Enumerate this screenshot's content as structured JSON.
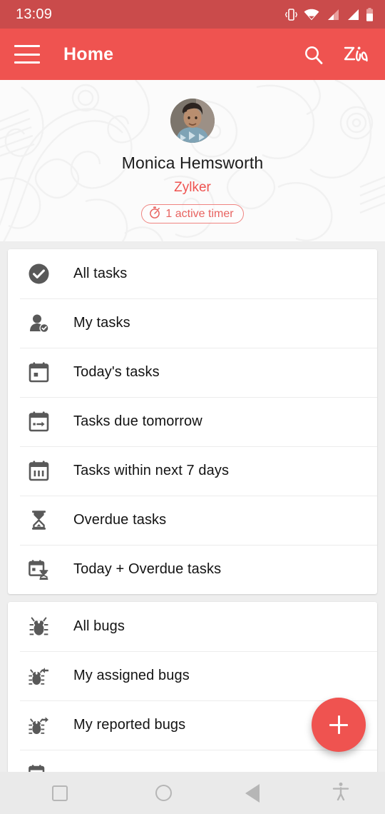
{
  "status_bar": {
    "time": "13:09",
    "icons": [
      "vibrate-icon",
      "wifi-icon",
      "signal-icon",
      "signal-icon",
      "battery-icon"
    ],
    "background_color": "#ca4b4b"
  },
  "toolbar": {
    "menu_icon": "hamburger-menu-icon",
    "title": "Home",
    "search_icon": "search-icon",
    "assistant_icon": "zia-assistant-icon",
    "background_color": "#ef5350"
  },
  "profile": {
    "avatar_icon": "user-avatar-photo",
    "name": "Monica Hemsworth",
    "company": "Zylker",
    "company_color": "#ef5350",
    "timer_badge": {
      "icon": "stopwatch-icon",
      "label": "1 active timer",
      "color": "#e8625f"
    }
  },
  "cards": [
    {
      "name": "tasks-card",
      "rows": [
        {
          "icon": "check-circle-icon",
          "label": "All tasks"
        },
        {
          "icon": "person-check-icon",
          "label": "My tasks"
        },
        {
          "icon": "calendar-today-icon",
          "label": "Today's tasks"
        },
        {
          "icon": "calendar-arrow-right-icon",
          "label": "Tasks due tomorrow"
        },
        {
          "icon": "calendar-week-icon",
          "label": "Tasks within next 7 days"
        },
        {
          "icon": "hourglass-icon",
          "label": "Overdue tasks"
        },
        {
          "icon": "calendar-hourglass-icon",
          "label": "Today + Overdue tasks"
        }
      ]
    },
    {
      "name": "bugs-card",
      "rows": [
        {
          "icon": "bug-icon",
          "label": "All bugs"
        },
        {
          "icon": "bug-arrow-in-icon",
          "label": "My assigned bugs"
        },
        {
          "icon": "bug-arrow-out-icon",
          "label": "My reported bugs"
        },
        {
          "icon": "calendar-bug-icon",
          "label": ""
        }
      ]
    }
  ],
  "fab": {
    "icon": "plus-icon",
    "color": "#ef5350"
  },
  "navigation_bar": {
    "buttons": [
      {
        "name": "recents-button",
        "icon": "square-icon"
      },
      {
        "name": "home-button",
        "icon": "circle-icon"
      },
      {
        "name": "back-button",
        "icon": "triangle-left-icon"
      },
      {
        "name": "accessibility-button",
        "icon": "accessibility-icon"
      }
    ],
    "background_color": "#eaeaea"
  }
}
